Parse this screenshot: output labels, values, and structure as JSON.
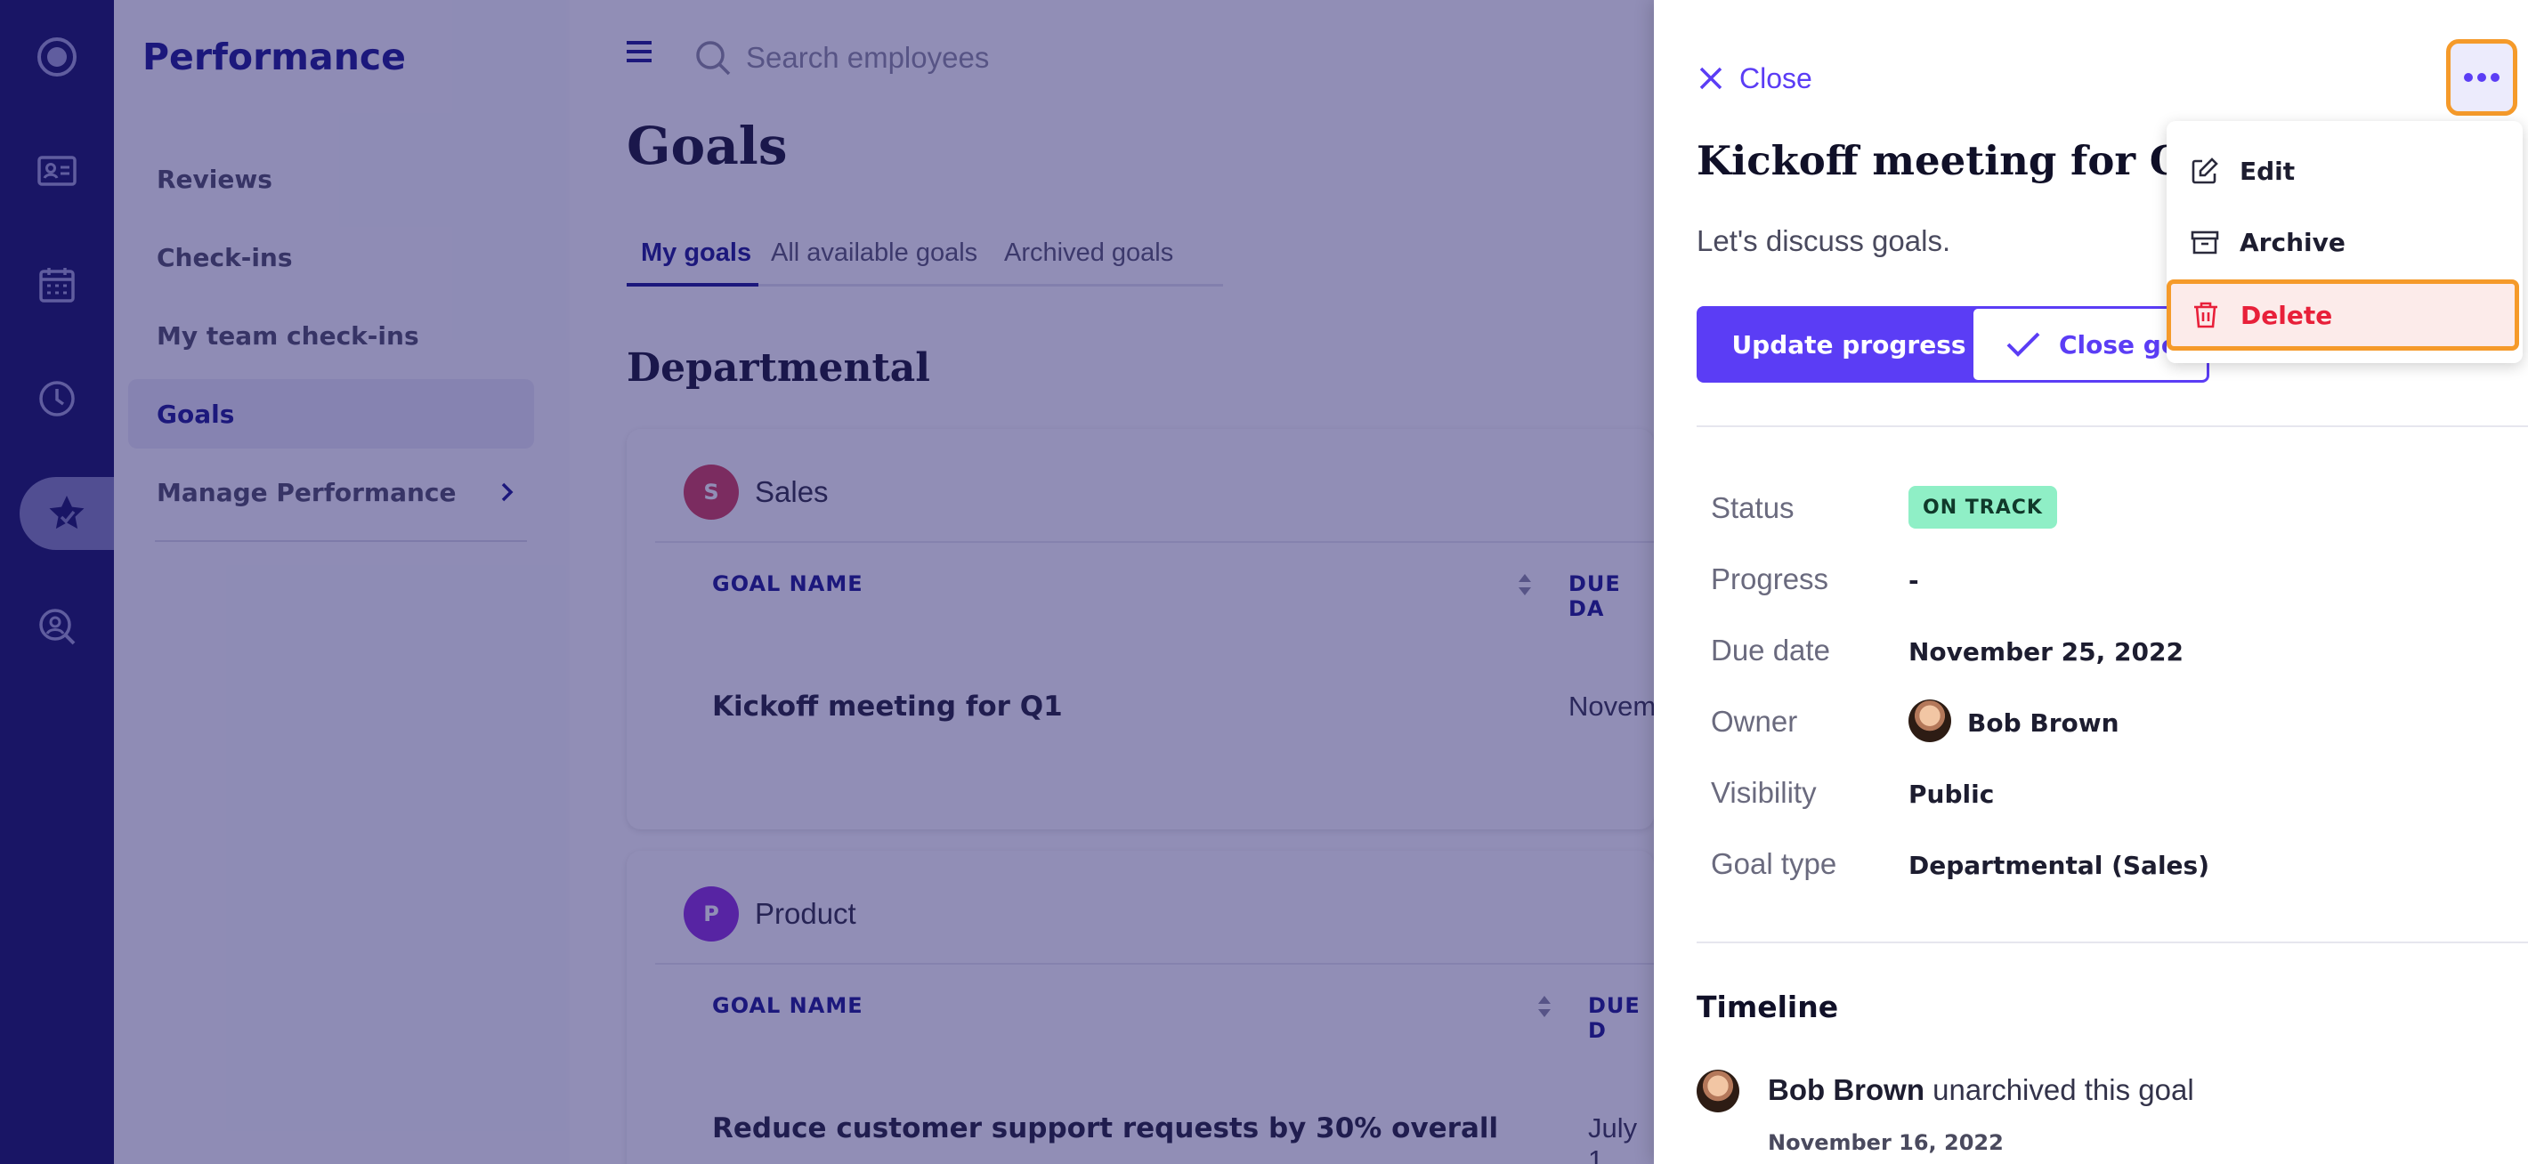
{
  "rail": {
    "items": [
      {
        "icon": "logo-icon"
      },
      {
        "icon": "id-card-icon"
      },
      {
        "icon": "calendar-icon"
      },
      {
        "icon": "clock-icon"
      },
      {
        "icon": "star-icon",
        "active": true
      },
      {
        "icon": "person-search-icon"
      }
    ]
  },
  "sidebar": {
    "title": "Performance",
    "items": [
      {
        "label": "Reviews"
      },
      {
        "label": "Check-ins"
      },
      {
        "label": "My team check-ins"
      },
      {
        "label": "Goals",
        "active": true
      },
      {
        "label": "Manage Performance"
      }
    ]
  },
  "main": {
    "search_placeholder": "Search employees",
    "page_title": "Goals",
    "tabs": [
      {
        "label": "My goals",
        "active": true
      },
      {
        "label": "All available goals"
      },
      {
        "label": "Archived goals"
      }
    ],
    "section_title": "Departmental",
    "cards": [
      {
        "avatar": "S",
        "avatar_color": "#d23a52",
        "name": "Sales",
        "col_goal": "GOAL NAME",
        "col_due": "DUE DA",
        "row_name": "Kickoff meeting for Q1",
        "row_date": "Novem"
      },
      {
        "avatar": "P",
        "avatar_color": "#8a2bd8",
        "name": "Product",
        "col_goal": "GOAL NAME",
        "col_due": "DUE D",
        "row_name": "Reduce customer support requests by 30% overall",
        "row_date": "July 1"
      }
    ]
  },
  "drawer": {
    "close_label": "Close",
    "title": "Kickoff meeting for Q1",
    "description": "Let's discuss goals.",
    "update_button": "Update progress",
    "close_goal_button": "Close goal",
    "fields": {
      "status_label": "Status",
      "status_value": "ON TRACK",
      "progress_label": "Progress",
      "progress_value": "-",
      "due_label": "Due date",
      "due_value": "November 25, 2022",
      "owner_label": "Owner",
      "owner_value": "Bob Brown",
      "visibility_label": "Visibility",
      "visibility_value": "Public",
      "type_label": "Goal type",
      "type_value": "Departmental (Sales)"
    },
    "timeline": {
      "title": "Timeline",
      "entry_actor": "Bob Brown",
      "entry_action": " unarchived this goal",
      "entry_date": "November 16, 2022"
    }
  },
  "menu": {
    "edit": "Edit",
    "archive": "Archive",
    "delete": "Delete"
  },
  "colors": {
    "accent": "#5b3df5",
    "navy": "#15128a",
    "danger": "#e8203a",
    "highlight": "#f59a2a",
    "status_green": "#8fefc6"
  }
}
